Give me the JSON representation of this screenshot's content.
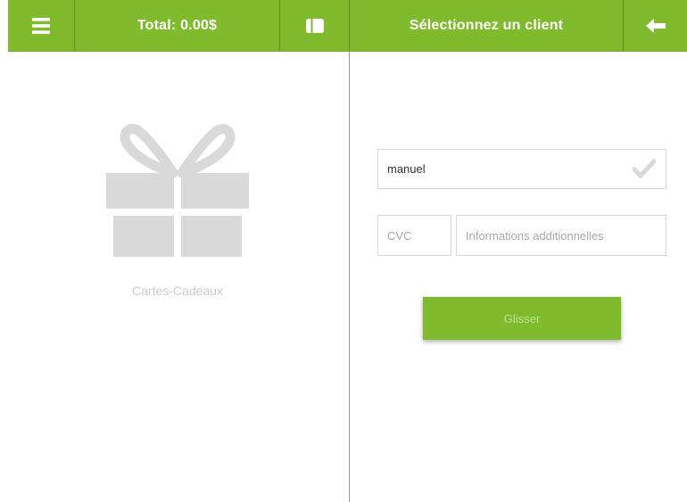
{
  "header": {
    "total_label": "Total: 0.00$",
    "title": "Sélectionnez un client"
  },
  "gift_section": {
    "label": "Cartes-Cadeaux"
  },
  "form": {
    "client_value": "manuel",
    "cvc_placeholder": "CVC",
    "info_placeholder": "Informations additionnelles",
    "swipe_label": "Glisser"
  },
  "colors": {
    "accent": "#7fbb2c",
    "icon_gray": "#d9d9d9"
  },
  "icons": {
    "menu": "hamburger-menu-icon",
    "card": "card-icon",
    "back": "arrow-left-icon",
    "gift": "gift-icon",
    "check": "checkmark-icon"
  }
}
